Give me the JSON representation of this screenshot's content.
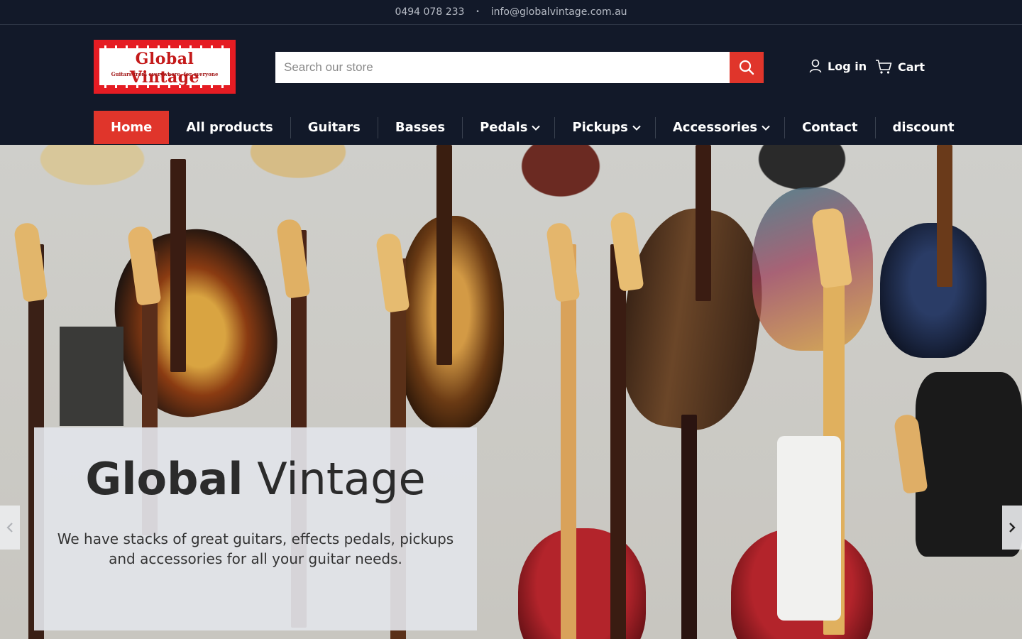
{
  "topbar": {
    "phone": "0494 078 233",
    "separator": "•",
    "email": "info@globalvintage.com.au"
  },
  "logo": {
    "title": "Global Vintage",
    "tagline": "Guitars from everywhere, for everyone"
  },
  "search": {
    "placeholder": "Search our store",
    "button_icon": "search-icon"
  },
  "account": {
    "login_label": "Log in",
    "icon": "user-icon"
  },
  "cart": {
    "label": "Cart",
    "icon": "cart-icon"
  },
  "nav": {
    "items": [
      {
        "label": "Home",
        "active": true,
        "dropdown": false
      },
      {
        "label": "All products",
        "active": false,
        "dropdown": false
      },
      {
        "label": "Guitars",
        "active": false,
        "dropdown": false
      },
      {
        "label": "Basses",
        "active": false,
        "dropdown": false
      },
      {
        "label": "Pedals",
        "active": false,
        "dropdown": true
      },
      {
        "label": "Pickups",
        "active": false,
        "dropdown": true
      },
      {
        "label": "Accessories",
        "active": false,
        "dropdown": true
      },
      {
        "label": "Contact",
        "active": false,
        "dropdown": false
      },
      {
        "label": "discount",
        "active": false,
        "dropdown": false
      }
    ]
  },
  "hero": {
    "title_bold": "Global",
    "title_light": "Vintage",
    "text": "We have stacks of great guitars, effects pedals, pickups and accessories for all your guitar needs.",
    "prev_icon": "chevron-left-icon",
    "next_icon": "chevron-right-icon"
  },
  "colors": {
    "background": "#121929",
    "accent": "#e0352b",
    "logo_red": "#e51c23"
  }
}
